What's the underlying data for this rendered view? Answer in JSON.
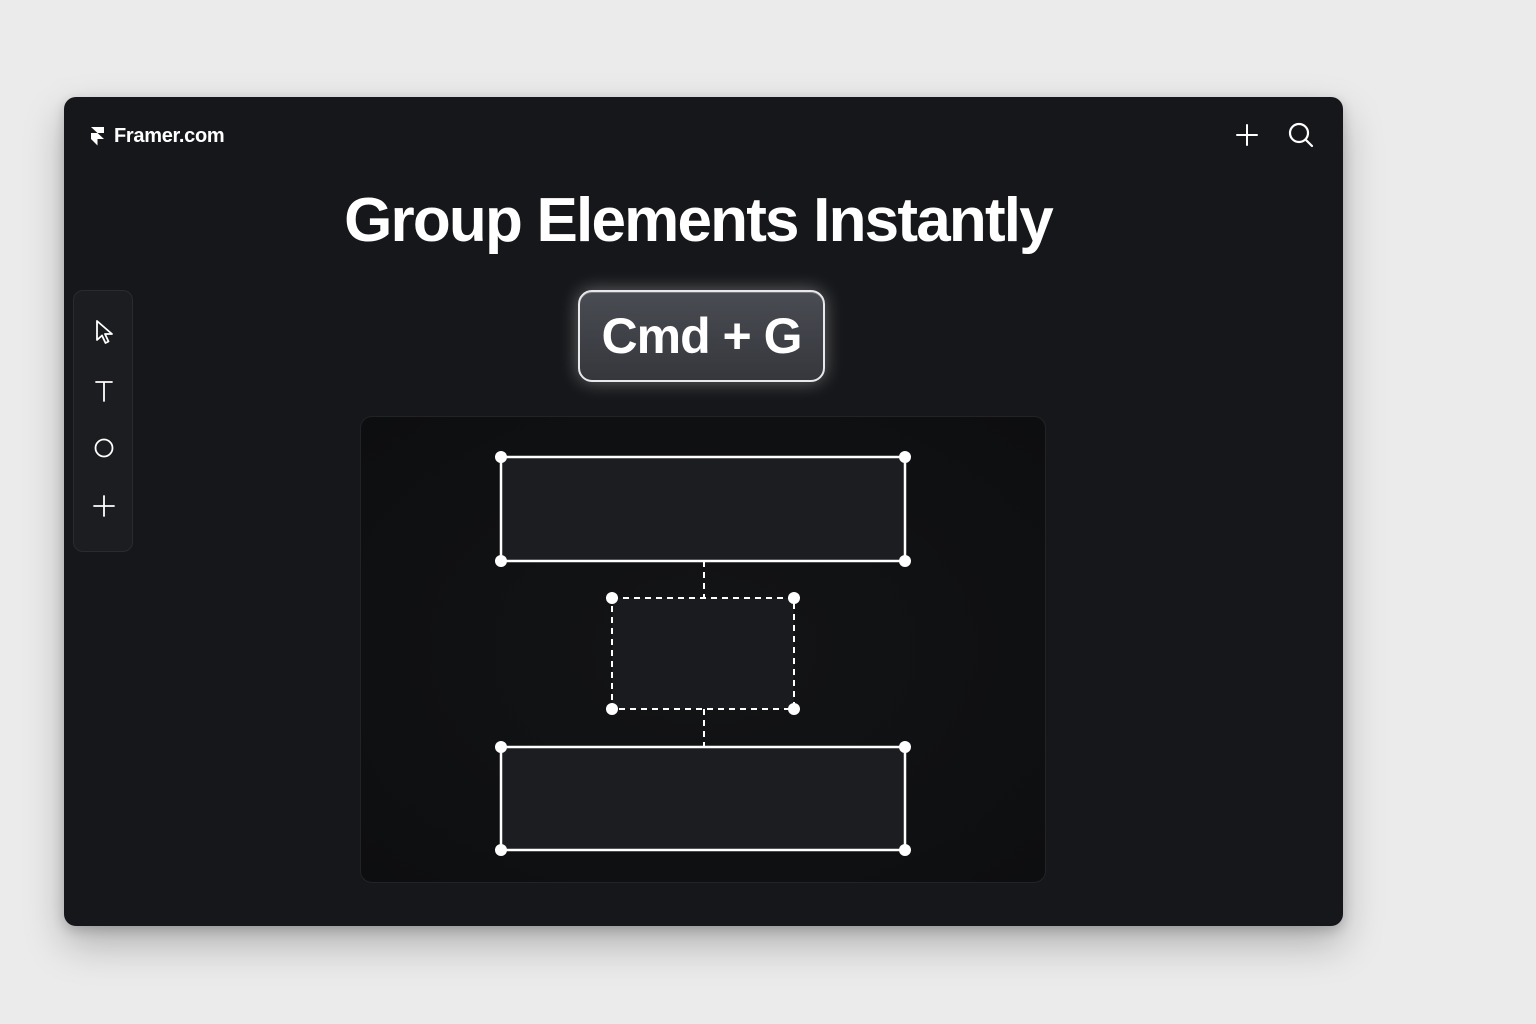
{
  "brand": {
    "name": "Framer.com",
    "logo_icon": "framer-logo-icon"
  },
  "header_actions": [
    {
      "icon": "plus-icon"
    },
    {
      "icon": "search-icon"
    }
  ],
  "hero": {
    "title": "Group Elements Instantly",
    "shortcut": "Cmd + G"
  },
  "toolbar": {
    "tools": [
      {
        "icon": "cursor-arrow-icon"
      },
      {
        "icon": "text-tool-icon"
      },
      {
        "icon": "ellipse-tool-icon"
      },
      {
        "icon": "plus-icon"
      }
    ]
  },
  "colors": {
    "page_background": "#ebebeb",
    "window_background": "#16171a",
    "canvas_background": "#0d0e10",
    "selection_stroke": "#ffffff",
    "shape_fill": "#1c1d20",
    "key_fill": "#3d3f45"
  }
}
